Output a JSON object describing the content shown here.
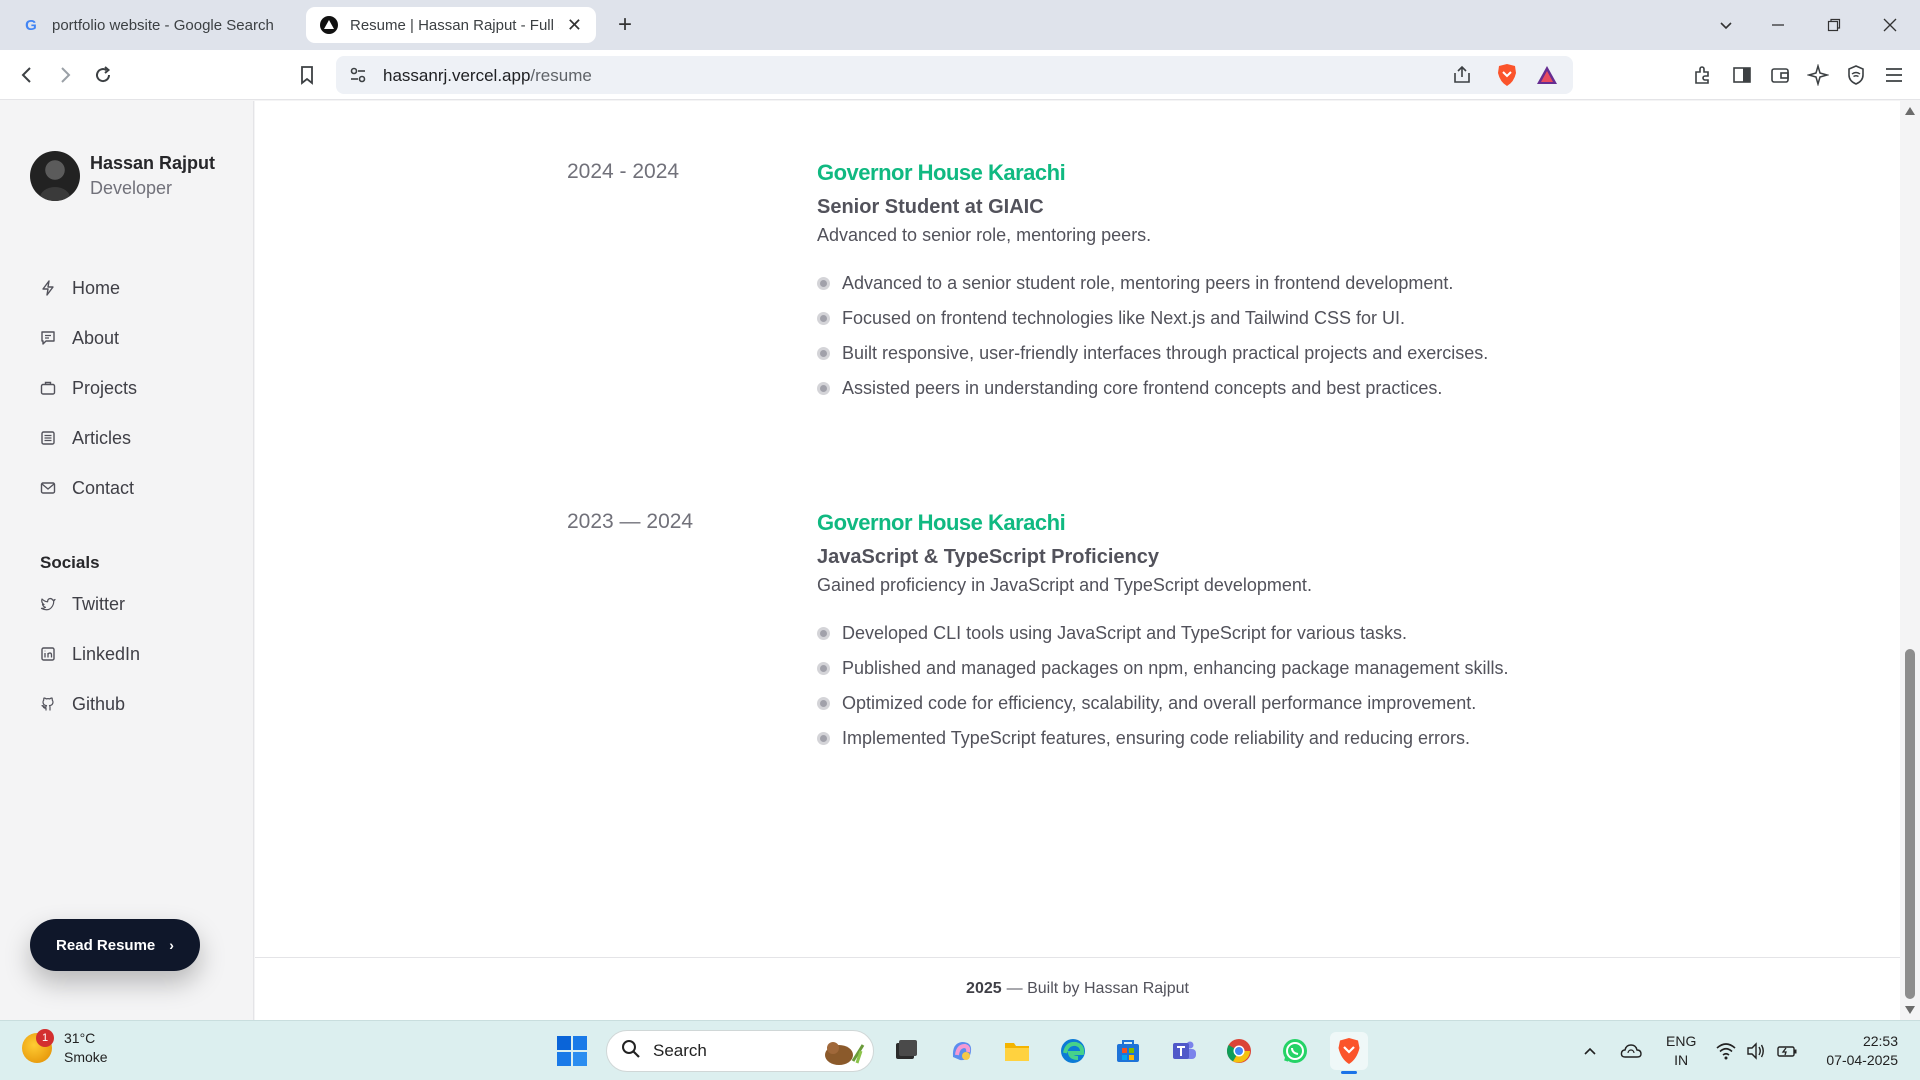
{
  "browser": {
    "tabs": [
      {
        "title": "portfolio website - Google Search",
        "active": false
      },
      {
        "title": "Resume | Hassan Rajput - Full Stack Developer",
        "active": true
      }
    ],
    "url_host": "hassanrj.vercel.app",
    "url_path": "/resume"
  },
  "sidebar": {
    "name": "Hassan Rajput",
    "role": "Developer",
    "nav": [
      {
        "label": "Home",
        "icon": "bolt-icon"
      },
      {
        "label": "About",
        "icon": "chat-icon"
      },
      {
        "label": "Projects",
        "icon": "briefcase-icon"
      },
      {
        "label": "Articles",
        "icon": "document-icon"
      },
      {
        "label": "Contact",
        "icon": "mail-icon"
      }
    ],
    "socials_heading": "Socials",
    "socials": [
      {
        "label": "Twitter",
        "icon": "twitter-icon"
      },
      {
        "label": "LinkedIn",
        "icon": "linkedin-icon"
      },
      {
        "label": "Github",
        "icon": "github-icon"
      }
    ],
    "resume_button": "Read Resume",
    "resume_chevron": "›"
  },
  "entries": [
    {
      "date": "2024 - 2024",
      "org": "Governor House Karachi",
      "role": "Senior Student at GIAIC",
      "desc": "Advanced to senior role, mentoring peers.",
      "bullets": [
        "Advanced to a senior student role, mentoring peers in frontend development.",
        "Focused on frontend technologies like Next.js and Tailwind CSS for UI.",
        "Built responsive, user-friendly interfaces through practical projects and exercises.",
        "Assisted peers in understanding core frontend concepts and best practices."
      ]
    },
    {
      "date": "2023 — 2024",
      "org": "Governor House Karachi",
      "role": "JavaScript & TypeScript Proficiency",
      "desc": "Gained proficiency in JavaScript and TypeScript development.",
      "bullets": [
        "Developed CLI tools using JavaScript and TypeScript for various tasks.",
        "Published and managed packages on npm, enhancing package management skills.",
        "Optimized code for efficiency, scalability, and overall performance improvement.",
        "Implemented TypeScript features, ensuring code reliability and reducing errors."
      ]
    }
  ],
  "footer": {
    "year": "2025",
    "text": "— Built by Hassan Rajput"
  },
  "taskbar": {
    "weather_badge": "1",
    "temperature": "31°C",
    "condition": "Smoke",
    "search_label": "Search",
    "lang_top": "ENG",
    "lang_bottom": "IN",
    "time": "22:53",
    "date": "07-04-2025"
  },
  "colors": {
    "accent": "#10b981",
    "button_dark": "#0f172a",
    "sidebar_bg": "#f4f4f5"
  }
}
